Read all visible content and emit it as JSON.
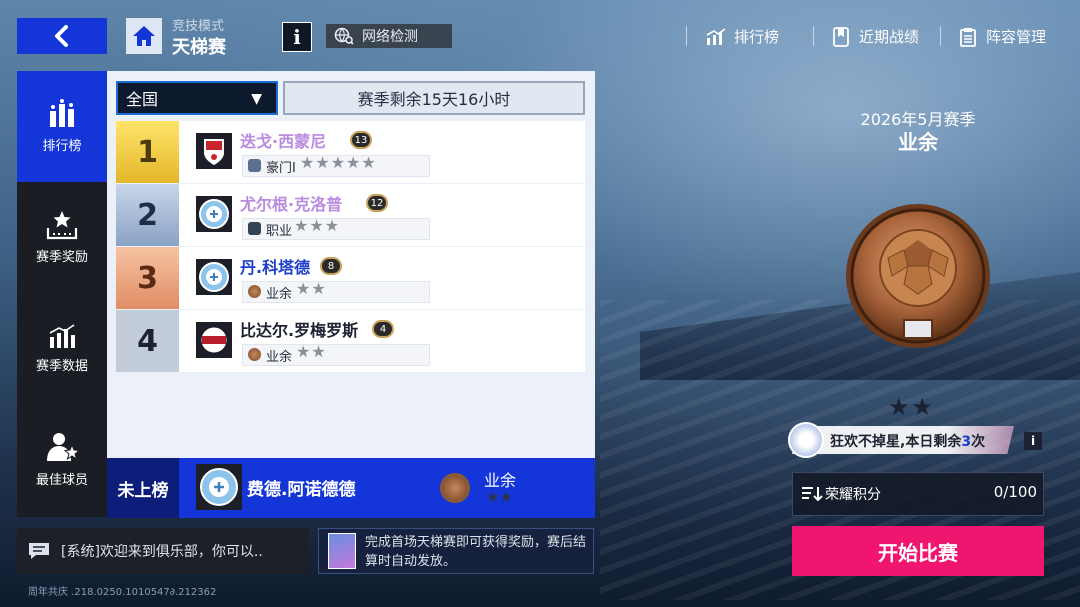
{
  "header": {
    "mode_small": "竞技模式",
    "mode_big": "天梯赛",
    "info_label": "i",
    "network_check": "网络检测",
    "nav": [
      "排行榜",
      "近期战绩",
      "阵容管理"
    ]
  },
  "tabs": [
    {
      "label": "排行榜",
      "icon": "leaderboard-icon",
      "active": true
    },
    {
      "label": "赛季奖励",
      "icon": "season-reward-icon",
      "active": false
    },
    {
      "label": "赛季数据",
      "icon": "season-stats-icon",
      "active": false
    },
    {
      "label": "最佳球员",
      "icon": "best-player-icon",
      "active": false
    }
  ],
  "leaderboard": {
    "region": "全国",
    "season_remaining": "赛季剩余15天16小时",
    "rows": [
      {
        "rank": "1",
        "name": "迭戈·西蒙尼",
        "level": "13",
        "tier": "豪门I",
        "stars": "★★★★★",
        "name_color": "#b98be0"
      },
      {
        "rank": "2",
        "name": "尤尔根·克洛普",
        "level": "12",
        "tier": "职业",
        "stars": "★★★",
        "name_color": "#b98be0"
      },
      {
        "rank": "3",
        "name": "丹.科塔德",
        "level": "8",
        "tier": "业余",
        "stars": "★★",
        "name_color": "#1c3fc8"
      },
      {
        "rank": "4",
        "name": "比达尔.罗梅罗斯",
        "level": "4",
        "tier": "业余",
        "stars": "★★",
        "name_color": "#1c2230"
      }
    ]
  },
  "my_rank": {
    "label": "未上榜",
    "name": "费德.阿诺德德",
    "tier": "业余",
    "stars": "★★"
  },
  "chat": {
    "text": "[系统]欢迎来到俱乐部，你可以.."
  },
  "tip": {
    "text": "完成首场天梯赛即可获得奖励，赛后结算时自动发放。"
  },
  "version": "周年共庆 .218.0250.1010547∂.212362",
  "season": {
    "date": "2026年5月赛季",
    "tier": "业余",
    "stars": "★★"
  },
  "banner": {
    "text_prefix": "狂欢不掉星,本日剩余",
    "count": "3",
    "text_suffix": "次",
    "info": "i"
  },
  "honor": {
    "label": "荣耀积分",
    "value": "0/100"
  },
  "start_button": "开始比赛",
  "colors": {
    "primary_blue": "#1436d8",
    "start_pink": "#f0156f",
    "gold": "#e7c23c",
    "silver": "#9fb3cf",
    "bronze": "#e8a07e"
  }
}
